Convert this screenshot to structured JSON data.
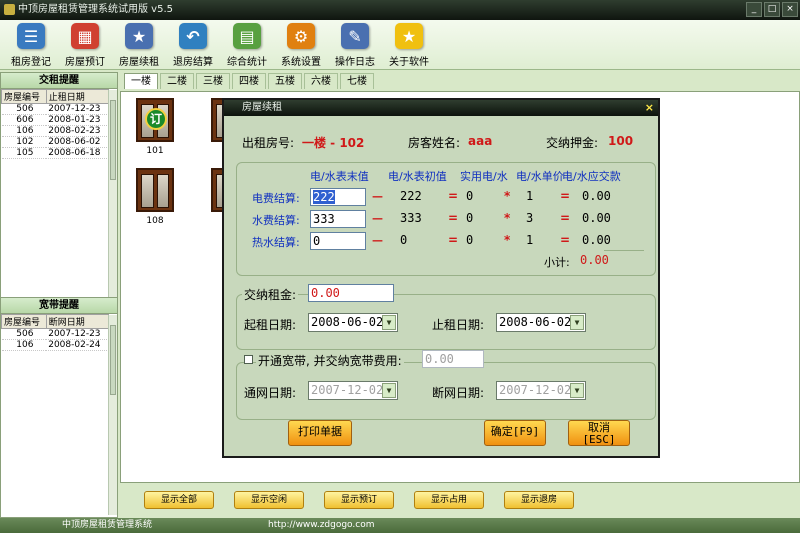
{
  "window": {
    "title": "中顶房屋租赁管理系统试用版 v5.5",
    "buttons": [
      "_",
      "□",
      "×"
    ]
  },
  "toolbar": [
    {
      "label": "租房登记",
      "icon": "rent-register-icon",
      "color": "#3a7ac0"
    },
    {
      "label": "房屋预订",
      "icon": "calendar-icon",
      "color": "#d04030"
    },
    {
      "label": "房屋续租",
      "icon": "document-star-icon",
      "color": "#4a70b0"
    },
    {
      "label": "退房结算",
      "icon": "return-arrow-icon",
      "color": "#3080c0"
    },
    {
      "label": "综合统计",
      "icon": "statistics-icon",
      "color": "#58a040"
    },
    {
      "label": "系统设置",
      "icon": "gear-icon",
      "color": "#e08010"
    },
    {
      "label": "操作日志",
      "icon": "log-icon",
      "color": "#4a70b0"
    },
    {
      "label": "关于软件",
      "icon": "star-icon",
      "color": "#f0c010"
    }
  ],
  "rent_reminder": {
    "title": "交租提醒",
    "headers": [
      "房屋编号",
      "止租日期"
    ],
    "rows": [
      [
        "506",
        "2007-12-23"
      ],
      [
        "606",
        "2008-01-23"
      ],
      [
        "106",
        "2008-02-23"
      ],
      [
        "102",
        "2008-06-02"
      ],
      [
        "105",
        "2008-06-18"
      ]
    ]
  },
  "net_reminder": {
    "title": "宽带提醒",
    "headers": [
      "房屋编号",
      "断网日期"
    ],
    "rows": [
      [
        "506",
        "2007-12-23"
      ],
      [
        "106",
        "2008-02-24"
      ]
    ]
  },
  "floors": [
    "一楼",
    "二楼",
    "三楼",
    "四楼",
    "五楼",
    "六楼",
    "七楼"
  ],
  "rooms": [
    {
      "number": "101",
      "badge": "订"
    },
    {
      "number": "108",
      "badge": ""
    }
  ],
  "bottom_buttons": [
    "显示全部",
    "显示空闲",
    "显示预订",
    "显示占用",
    "显示退房"
  ],
  "status": {
    "app": "中顶房屋租赁管理系统",
    "url": "http://www.zdgogo.com"
  },
  "dialog": {
    "title": "房屋续租",
    "close": "×",
    "room_label": "出租房号:",
    "room_value": "一楼 - 102",
    "tenant_label": "房客姓名:",
    "tenant_value": "aaa",
    "deposit_label": "交纳押金:",
    "deposit_value": "100",
    "meter_headers": {
      "end": "电/水表末值",
      "start": "电/水表初值",
      "used": "实用电/水",
      "price": "电/水单价",
      "due": "电/水应交款"
    },
    "meter_rows": [
      {
        "label": "电费结算:",
        "end": "222",
        "minus": "—",
        "start": "222",
        "eq": "=",
        "used": "0",
        "times": "*",
        "price": "1",
        "eq2": "=",
        "due": "0.00"
      },
      {
        "label": "水费结算:",
        "end": "333",
        "minus": "—",
        "start": "333",
        "eq": "=",
        "used": "0",
        "times": "*",
        "price": "3",
        "eq2": "=",
        "due": "0.00"
      },
      {
        "label": "热水结算:",
        "end": "0",
        "minus": "—",
        "start": "0",
        "eq": "=",
        "used": "0",
        "times": "*",
        "price": "1",
        "eq2": "=",
        "due": "0.00"
      }
    ],
    "subtotal_label": "小计:",
    "subtotal_value": "0.00",
    "rent_label": "交纳租金:",
    "rent_value": "0.00",
    "start_date_label": "起租日期:",
    "start_date": "2008-06-02",
    "end_date_label": "止租日期:",
    "end_date": "2008-06-02",
    "net_label": "开通宽带, 并交纳宽带费用:",
    "net_fee": "0.00",
    "net_start_label": "通网日期:",
    "net_start": "2007-12-02",
    "net_end_label": "断网日期:",
    "net_end": "2007-12-02",
    "print_button": "打印单据",
    "ok_button_line1": "确定[F9]",
    "cancel_button_line1": "取消",
    "cancel_button_line2": "[ESC]",
    "dropdown_arrow": "▼"
  }
}
